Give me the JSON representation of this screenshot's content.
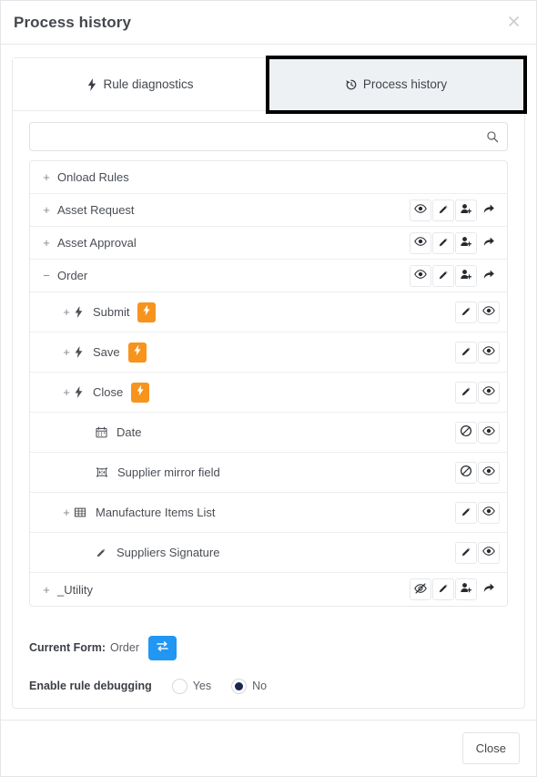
{
  "dialog": {
    "title": "Process history",
    "close_icon": "close-x-icon",
    "footer": {
      "close_label": "Close"
    }
  },
  "tabs": [
    {
      "id": "rule-diagnostics",
      "label": "Rule diagnostics",
      "icon": "lightning-bolt-icon",
      "active": false
    },
    {
      "id": "process-history",
      "label": "Process history",
      "icon": "history-clock-icon",
      "active": true
    }
  ],
  "search": {
    "value": "",
    "placeholder": "",
    "icon": "search-icon"
  },
  "tree": {
    "rows": [
      {
        "label": "Onload Rules",
        "indent": 0,
        "expander": "+",
        "lead_icon": "",
        "badge": false,
        "actions": []
      },
      {
        "label": "Asset Request",
        "indent": 0,
        "expander": "+",
        "lead_icon": "",
        "badge": false,
        "actions": [
          "eye-icon",
          "pencil-icon",
          "person-add-icon",
          "forward-arrow-icon"
        ]
      },
      {
        "label": "Asset Approval",
        "indent": 0,
        "expander": "+",
        "lead_icon": "",
        "badge": false,
        "actions": [
          "eye-icon",
          "pencil-icon",
          "person-add-icon",
          "forward-arrow-icon"
        ]
      },
      {
        "label": "Order",
        "indent": 0,
        "expander": "−",
        "lead_icon": "",
        "badge": false,
        "actions": [
          "eye-icon",
          "pencil-icon",
          "person-add-icon",
          "forward-arrow-icon"
        ]
      },
      {
        "label": "Submit",
        "indent": 1,
        "expander": "+",
        "lead_icon": "lightning-bolt-icon",
        "badge": true,
        "actions": [
          "pencil-icon",
          "eye-icon"
        ]
      },
      {
        "label": "Save",
        "indent": 1,
        "expander": "+",
        "lead_icon": "lightning-bolt-icon",
        "badge": true,
        "actions": [
          "pencil-icon",
          "eye-icon"
        ]
      },
      {
        "label": "Close",
        "indent": 1,
        "expander": "+",
        "lead_icon": "lightning-bolt-icon",
        "badge": true,
        "actions": [
          "pencil-icon",
          "eye-icon"
        ]
      },
      {
        "label": "Date",
        "indent": 2,
        "expander": "",
        "lead_icon": "calendar-icon",
        "badge": false,
        "actions": [
          "no-entry-icon",
          "eye-icon"
        ]
      },
      {
        "label": "Supplier mirror field",
        "indent": 2,
        "expander": "",
        "lead_icon": "mirror-field-icon",
        "badge": false,
        "actions": [
          "no-entry-icon",
          "eye-icon"
        ]
      },
      {
        "label": "Manufacture Items List",
        "indent": 1,
        "expander": "+",
        "lead_icon": "table-grid-icon",
        "badge": false,
        "actions": [
          "pencil-icon",
          "eye-icon"
        ]
      },
      {
        "label": "Suppliers Signature",
        "indent": 2,
        "expander": "",
        "lead_icon": "signature-pencil-icon",
        "badge": false,
        "actions": [
          "pencil-icon",
          "eye-icon"
        ]
      },
      {
        "label": "_Utility",
        "indent": 0,
        "expander": "+",
        "lead_icon": "",
        "badge": false,
        "actions": [
          "eye-slash-icon",
          "pencil-icon",
          "person-add-icon",
          "forward-arrow-icon"
        ]
      }
    ]
  },
  "controls": {
    "current_form_label": "Current Form:",
    "current_form_value": "Order",
    "swap_icon": "swap-arrows-icon",
    "debug_label": "Enable rule debugging",
    "debug_options": [
      {
        "label": "Yes",
        "selected": false
      },
      {
        "label": "No",
        "selected": true
      }
    ]
  },
  "colors": {
    "badge_orange": "#f7941e",
    "swap_blue": "#2196f3",
    "radio_navy": "#1a2553",
    "tab_active_bg": "#eef1f3",
    "focus_outline": "#000000"
  }
}
